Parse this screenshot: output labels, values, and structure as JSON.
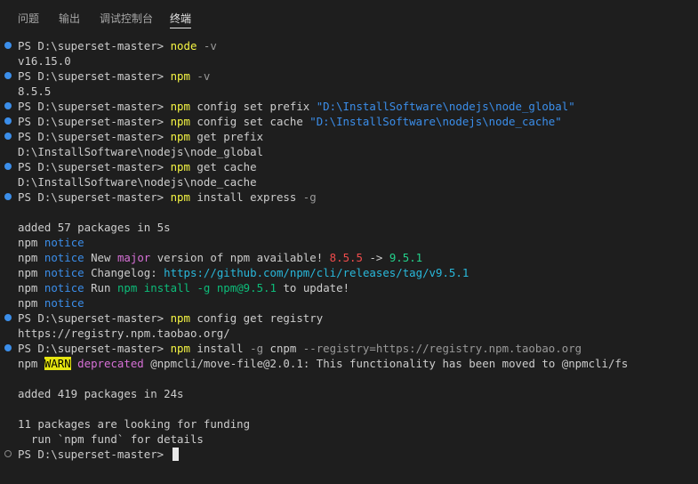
{
  "tabs": [
    "问题",
    "输出",
    "调试控制台",
    "终端"
  ],
  "active_tab": "终端",
  "terminal": {
    "prompt": "PS D:\\superset-master> ",
    "l1_cmd": "node",
    "l1_arg": " -v",
    "l2_out": "v16.15.0",
    "l3_cmd": "npm",
    "l3_arg": " -v",
    "l4_out": "8.5.5",
    "l5_cmd": "npm",
    "l5_rest": " config set prefix ",
    "l5_str": "\"D:\\InstallSoftware\\nodejs\\node_global\"",
    "l6_cmd": "npm",
    "l6_rest": " config set cache ",
    "l6_str": "\"D:\\InstallSoftware\\nodejs\\node_cache\"",
    "l7_cmd": "npm",
    "l7_rest": " get prefix",
    "l8_out": "D:\\InstallSoftware\\nodejs\\node_global",
    "l9_cmd": "npm",
    "l9_rest": " get cache",
    "l10_out": "D:\\InstallSoftware\\nodejs\\node_cache",
    "l11_cmd": "npm",
    "l11_rest": " install express ",
    "l11_flag": "-g",
    "l13_out": "added 57 packages in 5s",
    "npm": "npm",
    "notice": "notice",
    "l15_a": " New ",
    "l15_major": "major",
    "l15_b": " version of npm available! ",
    "l15_old": "8.5.5",
    "l15_arrow": " -> ",
    "l15_new": "9.5.1",
    "l16_a": " Changelog: ",
    "l16_url": "https://github.com/npm/cli/releases/tag/v9.5.1",
    "l17_a": " Run ",
    "l17_cmd": "npm install -g npm@9.5.1",
    "l17_b": " to update!",
    "l19_cmd": "npm",
    "l19_rest": " config get registry",
    "l20_out": "https://registry.npm.taobao.org/",
    "l21_cmd": "npm",
    "l21_rest": " install ",
    "l21_param": "-g",
    "l21_mid": " cnpm ",
    "l21_param2": "--registry=https://registry.npm.taobao.org",
    "l22_warn": "WARN",
    "l22_dep": "deprecated",
    "l22_rest": " @npmcli/move-file@2.0.1: This functionality has been moved to @npmcli/fs",
    "l24_out": "added 419 packages in 24s",
    "l26_out": "11 packages are looking for funding",
    "l27_out": "  run `npm fund` for details",
    "l28_prompt": "PS D:\\superset-master> "
  }
}
